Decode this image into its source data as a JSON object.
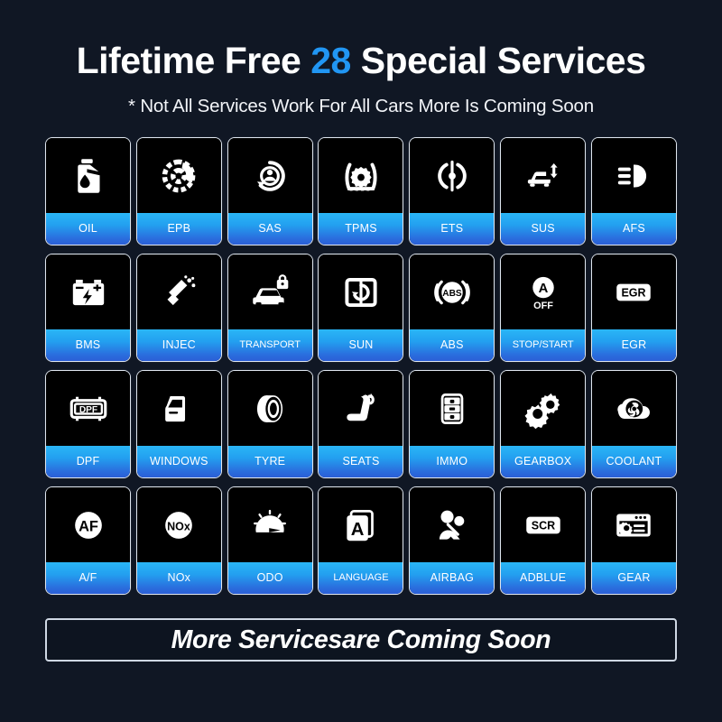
{
  "header": {
    "title_before": "Lifetime Free ",
    "title_accent": "28",
    "title_after": " Special Services",
    "subtitle": "* Not All Services Work For All Cars More Is Coming Soon",
    "accent_color": "#2196f3"
  },
  "theme": {
    "background": "#101724",
    "card_background": "#000000",
    "card_border": "#dfe6ef",
    "label_gradient_top": "#2ab6f6",
    "label_gradient_bottom": "#2b5ed6",
    "text_color": "#ffffff"
  },
  "services": [
    {
      "label": "OIL",
      "icon": "oil-can-icon"
    },
    {
      "label": "EPB",
      "icon": "brake-disc-icon"
    },
    {
      "label": "SAS",
      "icon": "steering-angle-icon"
    },
    {
      "label": "TPMS",
      "icon": "tire-pressure-gear-icon"
    },
    {
      "label": "ETS",
      "icon": "throttle-body-icon"
    },
    {
      "label": "SUS",
      "icon": "suspension-car-icon"
    },
    {
      "label": "AFS",
      "icon": "headlight-icon"
    },
    {
      "label": "BMS",
      "icon": "battery-icon"
    },
    {
      "label": "INJEC",
      "icon": "injector-icon"
    },
    {
      "label": "TRANSPORT",
      "icon": "car-lock-icon"
    },
    {
      "label": "SUN",
      "icon": "sunroof-icon"
    },
    {
      "label": "ABS",
      "icon": "abs-icon"
    },
    {
      "label": "STOP/START",
      "icon": "auto-stop-off-icon"
    },
    {
      "label": "EGR",
      "icon": "egr-badge-icon"
    },
    {
      "label": "DPF",
      "icon": "dpf-filter-icon"
    },
    {
      "label": "WINDOWS",
      "icon": "car-door-window-icon"
    },
    {
      "label": "TYRE",
      "icon": "tyre-icon"
    },
    {
      "label": "SEATS",
      "icon": "car-seat-icon"
    },
    {
      "label": "IMMO",
      "icon": "immobilizer-key-icon"
    },
    {
      "label": "GEARBOX",
      "icon": "gears-icon"
    },
    {
      "label": "COOLANT",
      "icon": "coolant-fan-icon"
    },
    {
      "label": "A/F",
      "icon": "af-circle-icon"
    },
    {
      "label": "NOx",
      "icon": "nox-circle-icon"
    },
    {
      "label": "ODO",
      "icon": "odometer-icon"
    },
    {
      "label": "LANGUAGE",
      "icon": "language-card-icon"
    },
    {
      "label": "AIRBAG",
      "icon": "airbag-icon"
    },
    {
      "label": "ADBLUE",
      "icon": "scr-badge-icon"
    },
    {
      "label": "GEAR",
      "icon": "gear-window-icon"
    }
  ],
  "footer": {
    "text": "More Servicesare Coming Soon"
  }
}
